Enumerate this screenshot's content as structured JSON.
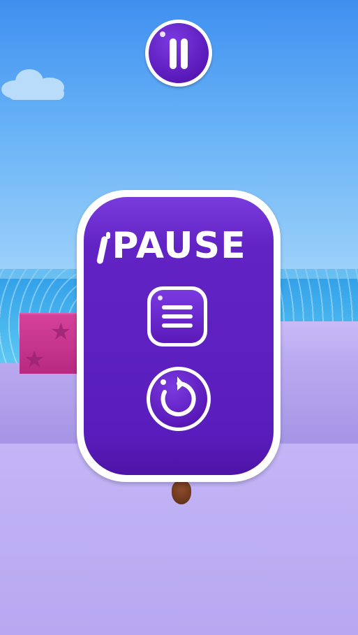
{
  "hud": {
    "pause_button_icon": "pause-icon"
  },
  "pause_panel": {
    "title": "PAUSE",
    "menu_button_icon": "hamburger-menu-icon",
    "restart_button_icon": "restart-icon"
  },
  "colors": {
    "panel_purple": "#5a1dbd",
    "button_purple": "#5a19b8",
    "sky_blue": "#3f8ff0",
    "road_lavender": "#c3b5f6",
    "block_pink": "#d6419a"
  }
}
